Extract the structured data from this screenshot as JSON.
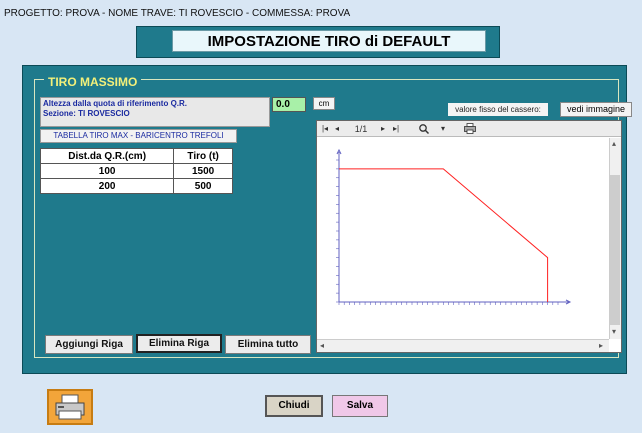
{
  "header": {
    "project_line": "PROGETTO: PROVA - NOME TRAVE: TI ROVESCIO - COMMESSA: PROVA",
    "title": "IMPOSTAZIONE TIRO di DEFAULT"
  },
  "group": {
    "legend": "TIRO MASSIMO"
  },
  "info": {
    "line1": "Altezza dalla quota di riferimento Q.R.",
    "line2": "Sezione: TI ROVESCIO",
    "quota_value": "0.0",
    "unit": "cm"
  },
  "fixed": {
    "label": "valore fisso del cassero:",
    "view_image_label": "vedi immagine"
  },
  "table": {
    "title": "TABELLA TIRO MAX - BARICENTRO TREFOLI",
    "headers": [
      "Dist.da Q.R.(cm)",
      "Tiro (t)"
    ],
    "rows": [
      [
        "100",
        "1500"
      ],
      [
        "200",
        "500"
      ]
    ]
  },
  "buttons": {
    "add_row": "Aggiungi Riga",
    "delete_row": "Elimina Riga",
    "delete_all": "Elimina tutto",
    "close": "Chiudi",
    "save": "Salva"
  },
  "viewer": {
    "page": "1/1"
  },
  "icons": {
    "printer": "printer-icon",
    "zoom": "magnifier-icon",
    "print_small": "print-icon"
  },
  "colors": {
    "panel": "#1f7a8c",
    "legend_text": "#f3f07a",
    "series": "#ff2020",
    "printer_button": "#f2a53a",
    "save_button": "#f0c8e8"
  },
  "chart_data": {
    "type": "line",
    "series": [
      {
        "values": [
          [
            0,
            1500
          ],
          [
            100,
            1500
          ],
          [
            200,
            500
          ],
          [
            200,
            0
          ]
        ]
      }
    ],
    "xlim": [
      0,
      210
    ],
    "ylim": [
      0,
      1600
    ],
    "grid": false
  }
}
